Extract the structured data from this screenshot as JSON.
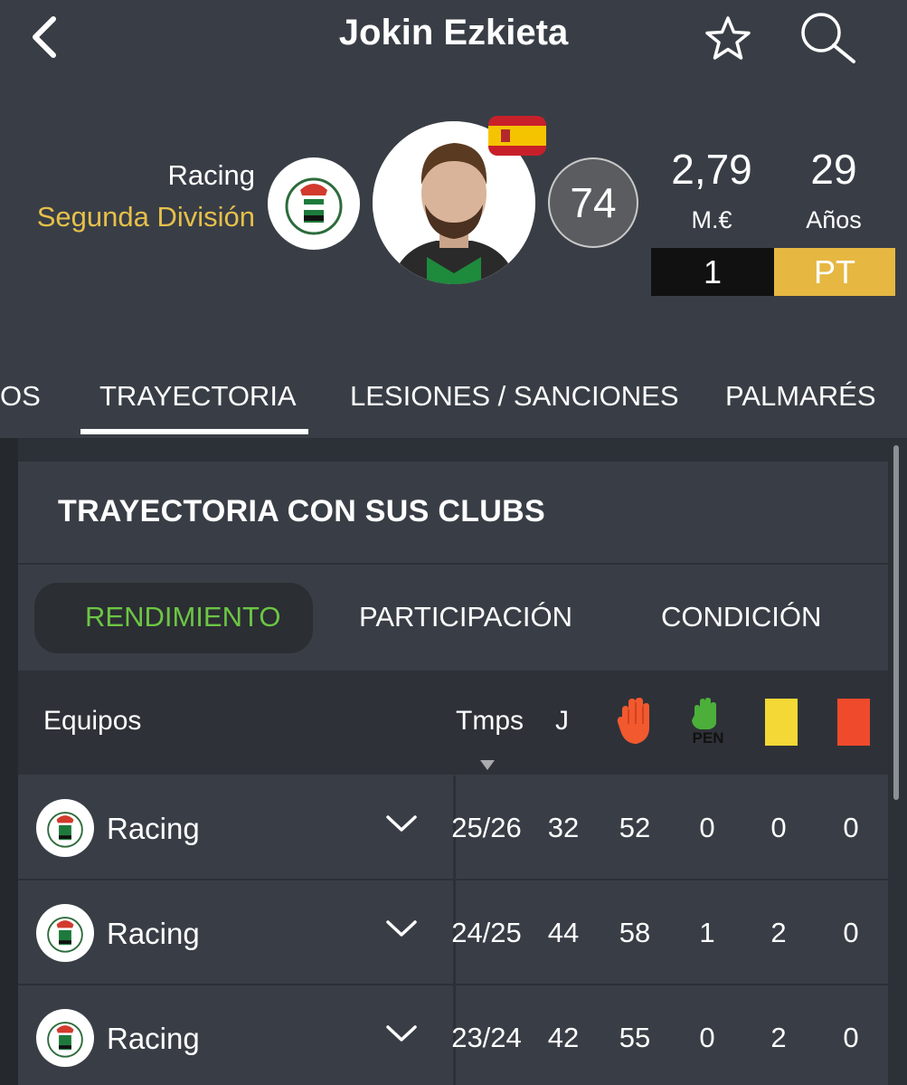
{
  "header": {
    "title": "Jokin Ezkieta",
    "club": "Racing",
    "league": "Segunda División",
    "rating": "74",
    "value": "2,79",
    "value_label": "M.€",
    "age": "29",
    "age_label": "Años",
    "number": "1",
    "position": "PT"
  },
  "tabs": [
    "OS",
    "TRAYECTORIA",
    "LESIONES / SANCIONES",
    "PALMARÉS"
  ],
  "active_tab": "TRAYECTORIA",
  "section": {
    "title": "TRAYECTORIA CON SUS CLUBS",
    "segments": [
      "RENDIMIENTO",
      "PARTICIPACIÓN",
      "CONDICIÓN"
    ],
    "active_segment": "RENDIMIENTO"
  },
  "table": {
    "col_teams": "Equipos",
    "col_season": "Tmps",
    "col_matches": "J",
    "pen_label": "PEN",
    "rows": [
      {
        "club": "Racing",
        "season": "25/26",
        "j": "32",
        "saves": "52",
        "pen": "0",
        "yellow": "0",
        "red": "0"
      },
      {
        "club": "Racing",
        "season": "24/25",
        "j": "44",
        "saves": "58",
        "pen": "1",
        "yellow": "2",
        "red": "0"
      },
      {
        "club": "Racing",
        "season": "23/24",
        "j": "42",
        "saves": "55",
        "pen": "0",
        "yellow": "2",
        "red": "0"
      }
    ]
  },
  "colors": {
    "accent_gold": "#e6c04a",
    "active_green": "#6cc644",
    "yellow_card": "#f4d836",
    "red_card": "#f04a2c",
    "glove_orange": "#f2592f",
    "glove_green": "#4caf3a"
  },
  "icons": [
    "back-icon",
    "star-icon",
    "search-icon",
    "glove-icon",
    "penalty-glove-icon",
    "yellow-card-icon",
    "red-card-icon",
    "chevron-down-icon"
  ]
}
